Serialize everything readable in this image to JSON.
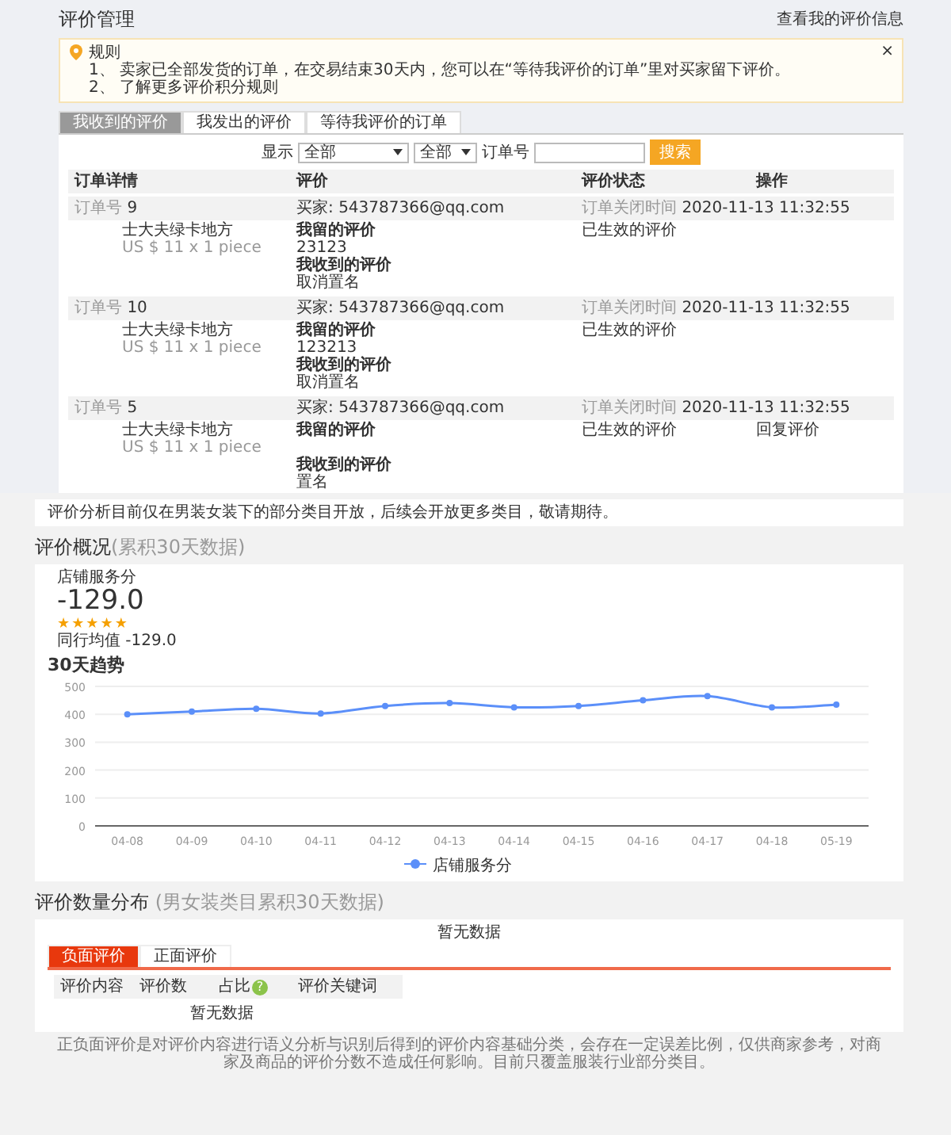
{
  "header": {
    "title": "评价管理",
    "link": "查看我的评价信息"
  },
  "notice": {
    "title": "规则",
    "lines": [
      "1、 卖家已全部发货的订单，在交易结束30天内，您可以在“等待我评价的订单”里对买家留下评价。",
      "2、 了解更多评价积分规则"
    ],
    "close": "×"
  },
  "tabs": [
    {
      "label": "我收到的评价",
      "selected": true
    },
    {
      "label": "我发出的评价",
      "selected": false
    },
    {
      "label": "等待我评价的订单",
      "selected": false
    }
  ],
  "filter": {
    "show_label": "显示",
    "select_1": "全部",
    "select_2": "全部",
    "order_label": "订单号",
    "button": "搜索"
  },
  "table": {
    "columns": [
      "订单详情",
      "评价",
      "评价状态",
      "操作"
    ],
    "orders": [
      {
        "order_label": "订单号",
        "order_no": "9",
        "buyer_label": "买家:",
        "buyer": "543787366@qq.com",
        "close_label": "订单关闭时间",
        "close_time": "2020-11-13 11:32:55",
        "product": "士大夫绿卡地方",
        "price": "US $ 11 x 1 piece",
        "my_label": "我留的评价",
        "my_review": "23123",
        "got_label": "我收到的评价",
        "got_review": "取消置名",
        "status": "已生效的评价"
      },
      {
        "order_label": "订单号",
        "order_no": "10",
        "buyer_label": "买家:",
        "buyer": "543787366@qq.com",
        "close_label": "订单关闭时间",
        "close_time": "2020-11-13 11:32:55",
        "product": "士大夫绿卡地方",
        "price": "US $ 11 x 1 piece",
        "my_label": "我留的评价",
        "my_review": "123213",
        "got_label": "我收到的评价",
        "got_review": "取消置名",
        "status": "已生效的评价"
      },
      {
        "order_label": "订单号",
        "order_no": "5",
        "buyer_label": "买家:",
        "buyer": "543787366@qq.com",
        "close_label": "订单关闭时间",
        "close_time": "2020-11-13 11:32:55",
        "product": "士大夫绿卡地方",
        "price": "US $ 11 x 1 piece",
        "my_label": "我留的评价",
        "got_label": "我收到的评价",
        "got_review": "置名",
        "status": "已生效的评价",
        "action": "回复评价"
      }
    ]
  },
  "analysis_notice": "评价分析目前仅在男装女装下的部分类目开放，后续会开放更多类目，敬请期待。",
  "overview": {
    "title": "评价概况",
    "subtitle": "(累积30天数据)",
    "score_label": "店铺服务分",
    "score": "-129.0",
    "stars": 5,
    "peer": "同行均值 -129.0",
    "trend_title": "30天趋势",
    "chart_data": {
      "type": "line",
      "categories": [
        "04-08",
        "04-09",
        "04-10",
        "04-11",
        "04-12",
        "04-13",
        "04-14",
        "04-15",
        "04-16",
        "04-17",
        "04-18",
        "05-19"
      ],
      "series": [
        {
          "name": "店铺服务分",
          "color": "#5b8ff9",
          "values": [
            400,
            410,
            420,
            403,
            430,
            440,
            425,
            430,
            450,
            465,
            425,
            435
          ]
        }
      ],
      "ylim": [
        0,
        500
      ],
      "yticks": [
        0,
        100,
        200,
        300,
        400,
        500
      ],
      "grid": true,
      "marker": true
    }
  },
  "distribution": {
    "title": "评价数量分布",
    "subtitle": "(男女装类目累积30天数据)",
    "empty_top": "暂无数据",
    "tabs": [
      {
        "label": "负面评价",
        "selected": true
      },
      {
        "label": "正面评价",
        "selected": false
      }
    ],
    "columns": [
      "评价内容",
      "评价数",
      "占比",
      "评价关键词"
    ],
    "help": "?",
    "empty": "暂无数据"
  },
  "footer": "正负面评价是对评价内容进行语义分析与识别后得到的评价内容基础分类，会存在一定误差比例，仅供商家参考，对商家及商品的评价分数不造成任何影响。目前只覆盖服装行业部分类目。"
}
